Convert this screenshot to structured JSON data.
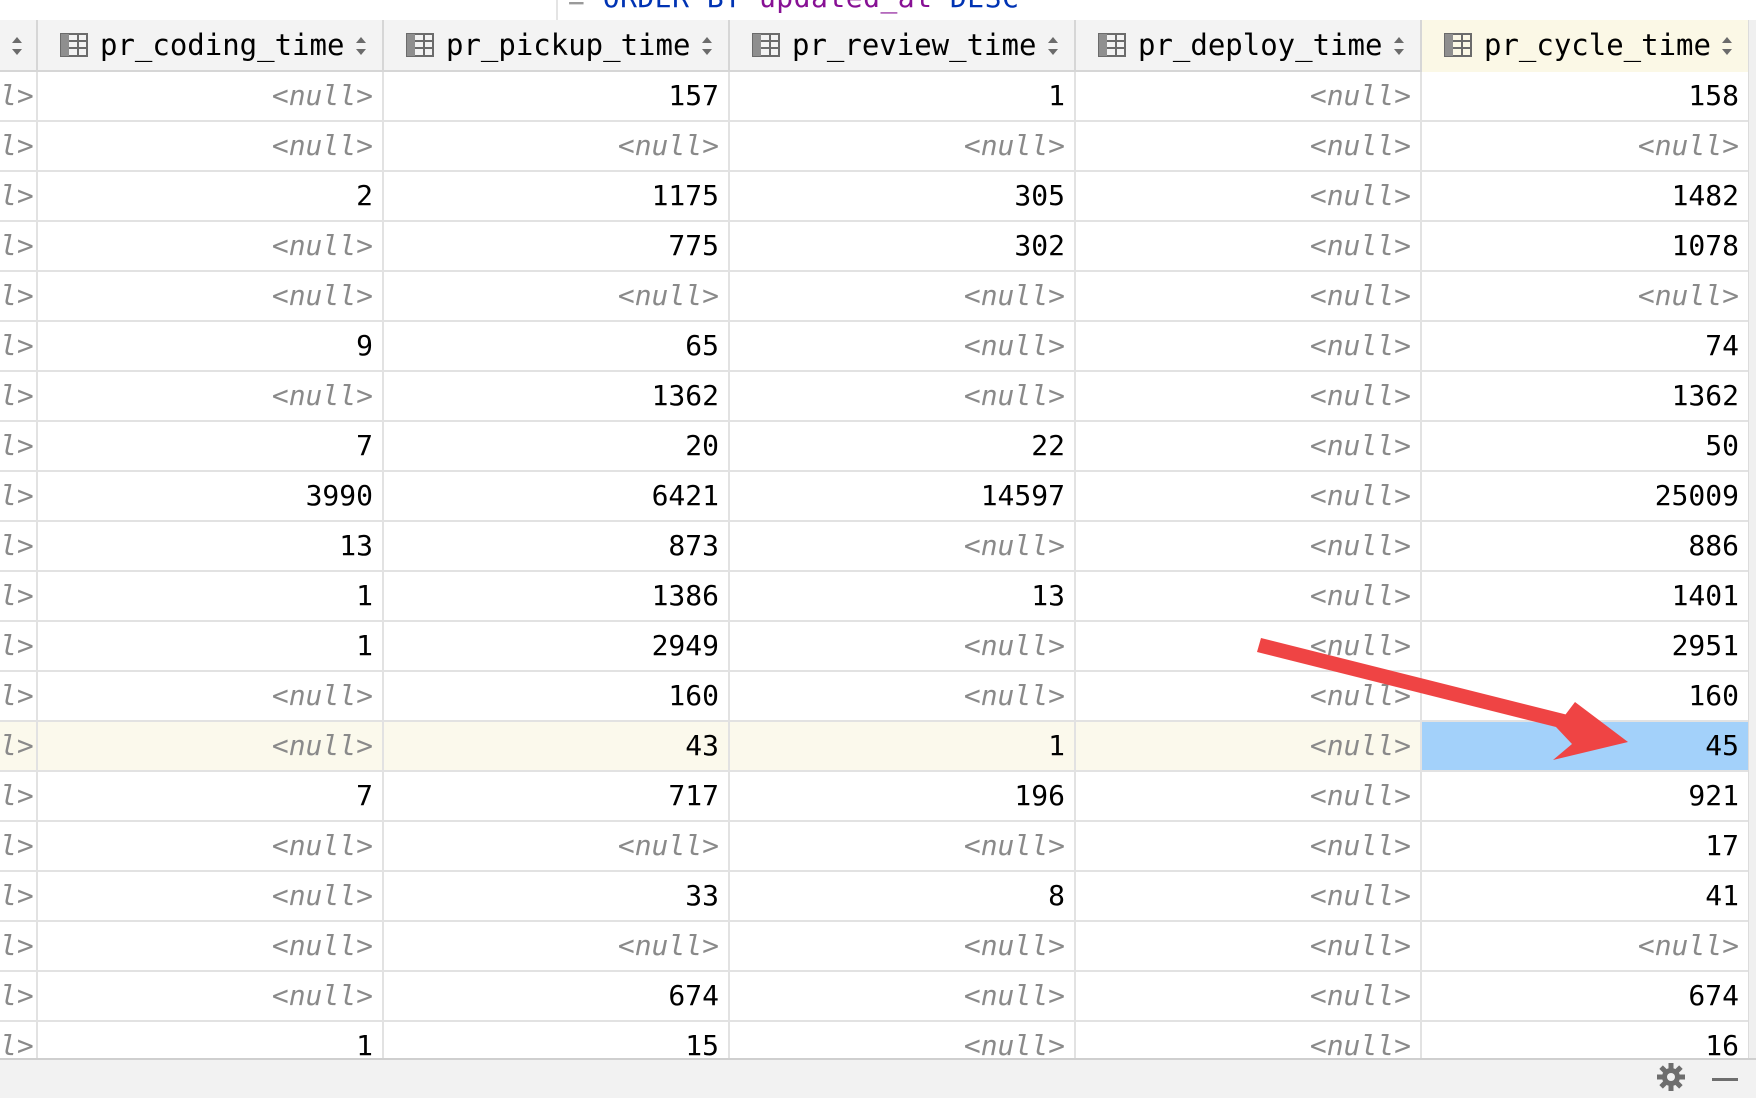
{
  "editor": {
    "sql_keyword": "ORDER BY",
    "sql_identifier": "updated_at",
    "sql_order": "DESC"
  },
  "columns": [
    {
      "label": "pr_coding_time"
    },
    {
      "label": "pr_pickup_time"
    },
    {
      "label": "pr_review_time"
    },
    {
      "label": "pr_deploy_time"
    },
    {
      "label": "pr_cycle_time"
    }
  ],
  "partial_column_text": "l>",
  "rows": [
    [
      "<null>",
      "157",
      "1",
      "<null>",
      "158"
    ],
    [
      "<null>",
      "<null>",
      "<null>",
      "<null>",
      "<null>"
    ],
    [
      "2",
      "1175",
      "305",
      "<null>",
      "1482"
    ],
    [
      "<null>",
      "775",
      "302",
      "<null>",
      "1078"
    ],
    [
      "<null>",
      "<null>",
      "<null>",
      "<null>",
      "<null>"
    ],
    [
      "9",
      "65",
      "<null>",
      "<null>",
      "74"
    ],
    [
      "<null>",
      "1362",
      "<null>",
      "<null>",
      "1362"
    ],
    [
      "7",
      "20",
      "22",
      "<null>",
      "50"
    ],
    [
      "3990",
      "6421",
      "14597",
      "<null>",
      "25009"
    ],
    [
      "13",
      "873",
      "<null>",
      "<null>",
      "886"
    ],
    [
      "1",
      "1386",
      "13",
      "<null>",
      "1401"
    ],
    [
      "1",
      "2949",
      "<null>",
      "<null>",
      "2951"
    ],
    [
      "<null>",
      "160",
      "<null>",
      "<null>",
      "160"
    ],
    [
      "<null>",
      "43",
      "1",
      "<null>",
      "45"
    ],
    [
      "7",
      "717",
      "196",
      "<null>",
      "921"
    ],
    [
      "<null>",
      "<null>",
      "<null>",
      "<null>",
      "17"
    ],
    [
      "<null>",
      "33",
      "8",
      "<null>",
      "41"
    ],
    [
      "<null>",
      "<null>",
      "<null>",
      "<null>",
      "<null>"
    ],
    [
      "<null>",
      "674",
      "<null>",
      "<null>",
      "674"
    ],
    [
      "1",
      "15",
      "<null>",
      "<null>",
      "16"
    ]
  ],
  "current_row": 13,
  "selected_cell": {
    "row": 13,
    "col": 4
  },
  "colors": {
    "selection": "#a3d1fa",
    "current_row": "#fbf9ec",
    "active_header": "#fbf8e6",
    "arrow": "#ef4444",
    "null_text": "#8a8a8a"
  },
  "icons": {
    "column_type": "table-icon",
    "sort": "sort-arrows-icon",
    "settings": "gear-icon",
    "hide": "minus-icon"
  }
}
